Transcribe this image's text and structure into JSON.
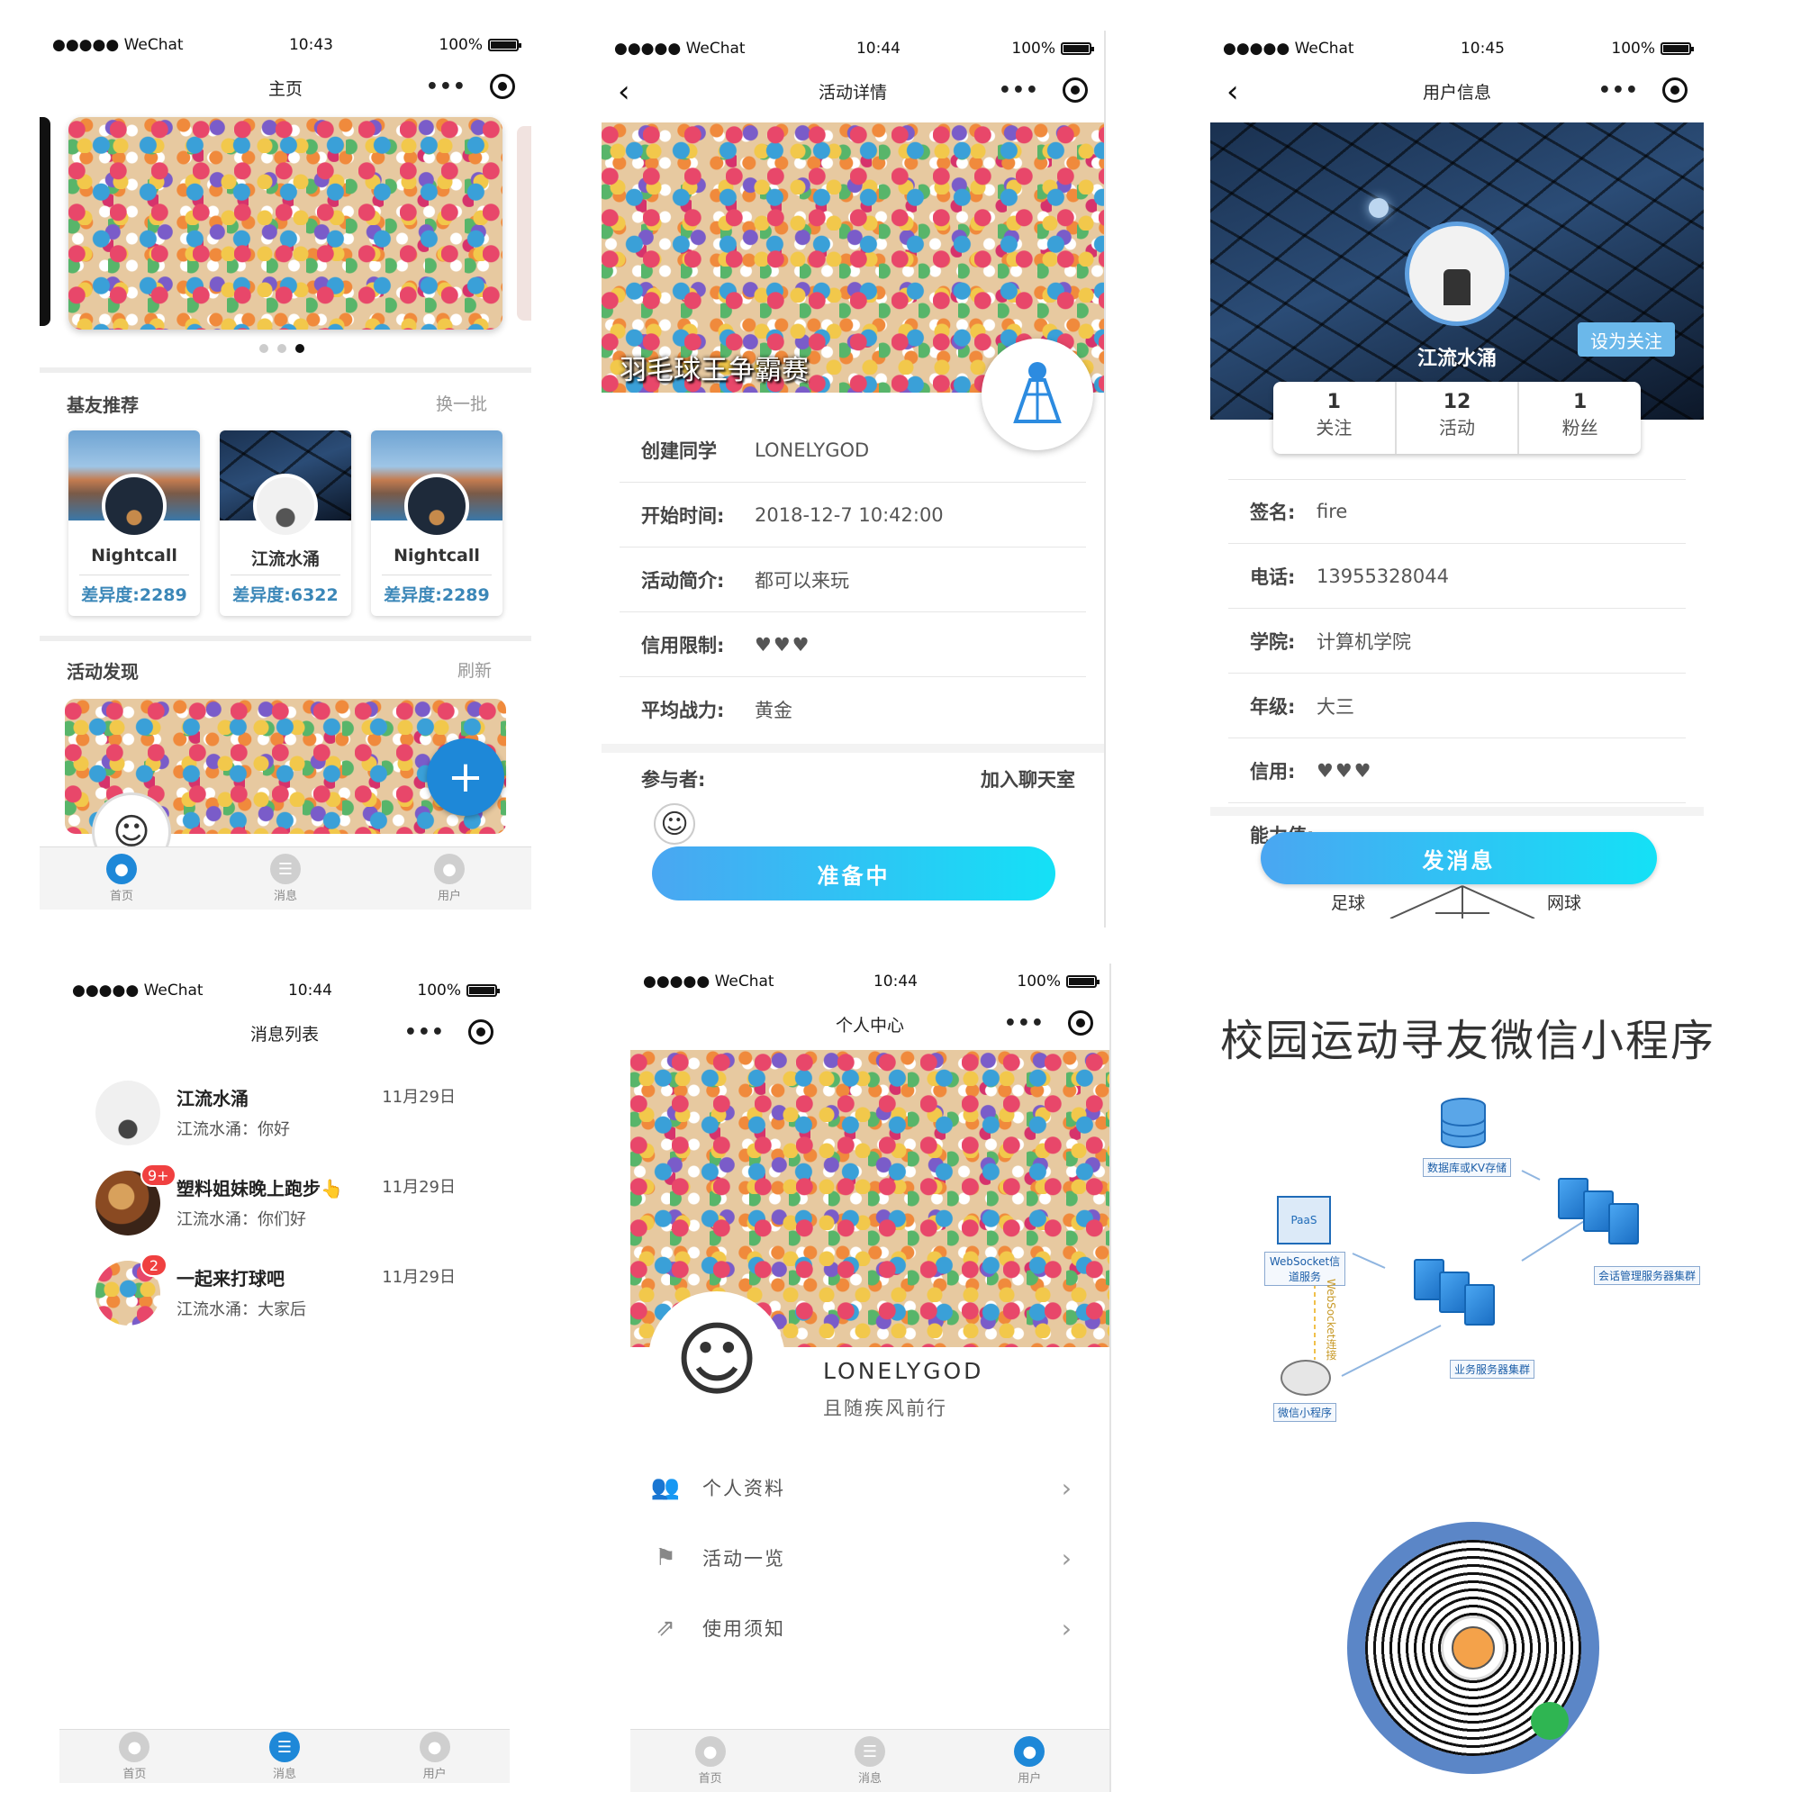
{
  "status_bar": {
    "carrier": "●●●●● WeChat",
    "battery": "100%",
    "times": {
      "home": "10:43",
      "detail": "10:44",
      "user_info": "10:45",
      "messages": "10:44",
      "center": "10:44"
    }
  },
  "home": {
    "title": "主页",
    "friends_section": {
      "title": "基友推荐",
      "action": "换一批"
    },
    "friends": [
      {
        "name": "Nightcall",
        "diff": "差异度:2289"
      },
      {
        "name": "江流水涌",
        "diff": "差异度:6322"
      },
      {
        "name": "Nightcall",
        "diff": "差异度:2289"
      }
    ],
    "activity_section": {
      "title": "活动发现",
      "action": "刷新"
    }
  },
  "tabbar": {
    "home": "首页",
    "messages": "消息",
    "user": "用户"
  },
  "detail": {
    "title": "活动详情",
    "activity_name": "羽毛球王争霸赛",
    "rows": [
      {
        "label": "创建同学",
        "value": "LONELYGOD"
      },
      {
        "label": "开始时间:",
        "value": "2018-12-7 10:42:00"
      },
      {
        "label": "活动简介:",
        "value": "都可以来玩"
      },
      {
        "label": "信用限制:",
        "value": "♥♥♥"
      },
      {
        "label": "平均战力:",
        "value": "黄金"
      }
    ],
    "participants_label": "参与者:",
    "join_chat": "加入聊天室",
    "button": "准备中"
  },
  "user_info": {
    "title": "用户信息",
    "name": "江流水涌",
    "follow_button": "设为关注",
    "stats": [
      {
        "value": "1",
        "label": "关注"
      },
      {
        "value": "12",
        "label": "活动"
      },
      {
        "value": "1",
        "label": "粉丝"
      }
    ],
    "rows": [
      {
        "label": "签名:",
        "value": "fire"
      },
      {
        "label": "电话:",
        "value": "13955328044"
      },
      {
        "label": "学院:",
        "value": "计算机学院"
      },
      {
        "label": "年级:",
        "value": "大三"
      },
      {
        "label": "信用:",
        "value": "♥♥♥"
      }
    ],
    "ability_label": "能力值:",
    "radar_labels": {
      "left": "足球",
      "right": "网球"
    },
    "message_button": "发消息"
  },
  "messages": {
    "title": "消息列表",
    "items": [
      {
        "name": "江流水涌",
        "last": "江流水涌：你好",
        "time": "11月29日",
        "badge": ""
      },
      {
        "name": "塑料姐妹晚上跑步👆",
        "last": "江流水涌：你们好",
        "time": "11月29日",
        "badge": "9+"
      },
      {
        "name": "一起来打球吧",
        "last": "江流水涌：大家后",
        "time": "11月29日",
        "badge": "2"
      }
    ]
  },
  "center": {
    "title": "个人中心",
    "username": "LONELYGOD",
    "motto": "且随疾风前行",
    "menu": [
      "个人资料",
      "活动一览",
      "使用须知"
    ]
  },
  "promo": {
    "headline": "校园运动寻友微信小程序",
    "diagram": {
      "db": "数据库或KV存储",
      "paas": "PaaS",
      "websocket": "WebSocket信道服务",
      "session": "会话管理服务器集群",
      "business": "业务服务器集群",
      "connection": "WebSocket连接",
      "miniapp": "微信小程序"
    }
  },
  "colors": {
    "accent": "#1e88d8",
    "gradient_start": "#4aa6f2",
    "gradient_end": "#14e1f6",
    "diff_text": "#3b87b8",
    "qr_ring": "#5b86c7"
  }
}
